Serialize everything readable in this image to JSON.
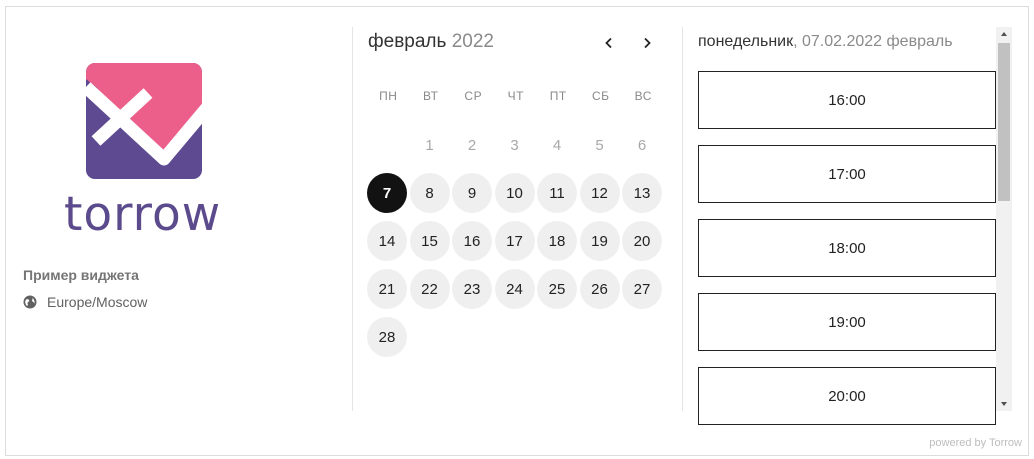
{
  "brand": {
    "logo_icon": "torrow-logo-icon",
    "name": "torrow",
    "colors": {
      "pink": "#ec5f8a",
      "purple": "#5e4a90"
    }
  },
  "widget": {
    "name": "Пример виджета",
    "timezone_icon": "globe-icon",
    "timezone": "Europe/Moscow"
  },
  "calendar": {
    "month": "февраль",
    "year": "2022",
    "prev_icon": "chevron-left-icon",
    "next_icon": "chevron-right-icon",
    "weekdays": [
      "ПН",
      "ВТ",
      "СР",
      "ЧТ",
      "ПТ",
      "СБ",
      "ВС"
    ],
    "weeks": [
      [
        {
          "d": "",
          "s": "empty"
        },
        {
          "d": "1",
          "s": "muted"
        },
        {
          "d": "2",
          "s": "muted"
        },
        {
          "d": "3",
          "s": "muted"
        },
        {
          "d": "4",
          "s": "muted"
        },
        {
          "d": "5",
          "s": "muted"
        },
        {
          "d": "6",
          "s": "muted"
        }
      ],
      [
        {
          "d": "7",
          "s": "selected"
        },
        {
          "d": "8",
          "s": "avail"
        },
        {
          "d": "9",
          "s": "avail"
        },
        {
          "d": "10",
          "s": "avail"
        },
        {
          "d": "11",
          "s": "avail"
        },
        {
          "d": "12",
          "s": "avail"
        },
        {
          "d": "13",
          "s": "avail"
        }
      ],
      [
        {
          "d": "14",
          "s": "avail"
        },
        {
          "d": "15",
          "s": "avail"
        },
        {
          "d": "16",
          "s": "avail"
        },
        {
          "d": "17",
          "s": "avail"
        },
        {
          "d": "18",
          "s": "avail"
        },
        {
          "d": "19",
          "s": "avail"
        },
        {
          "d": "20",
          "s": "avail"
        }
      ],
      [
        {
          "d": "21",
          "s": "avail"
        },
        {
          "d": "22",
          "s": "avail"
        },
        {
          "d": "23",
          "s": "avail"
        },
        {
          "d": "24",
          "s": "avail"
        },
        {
          "d": "25",
          "s": "avail"
        },
        {
          "d": "26",
          "s": "avail"
        },
        {
          "d": "27",
          "s": "avail"
        }
      ],
      [
        {
          "d": "28",
          "s": "avail"
        }
      ]
    ]
  },
  "slots": {
    "weekday": "понедельник",
    "rest": ", 07.02.2022 февраль",
    "times": [
      "16:00",
      "17:00",
      "18:00",
      "19:00",
      "20:00"
    ]
  },
  "footer": {
    "powered_by": "powered by Torrow"
  }
}
